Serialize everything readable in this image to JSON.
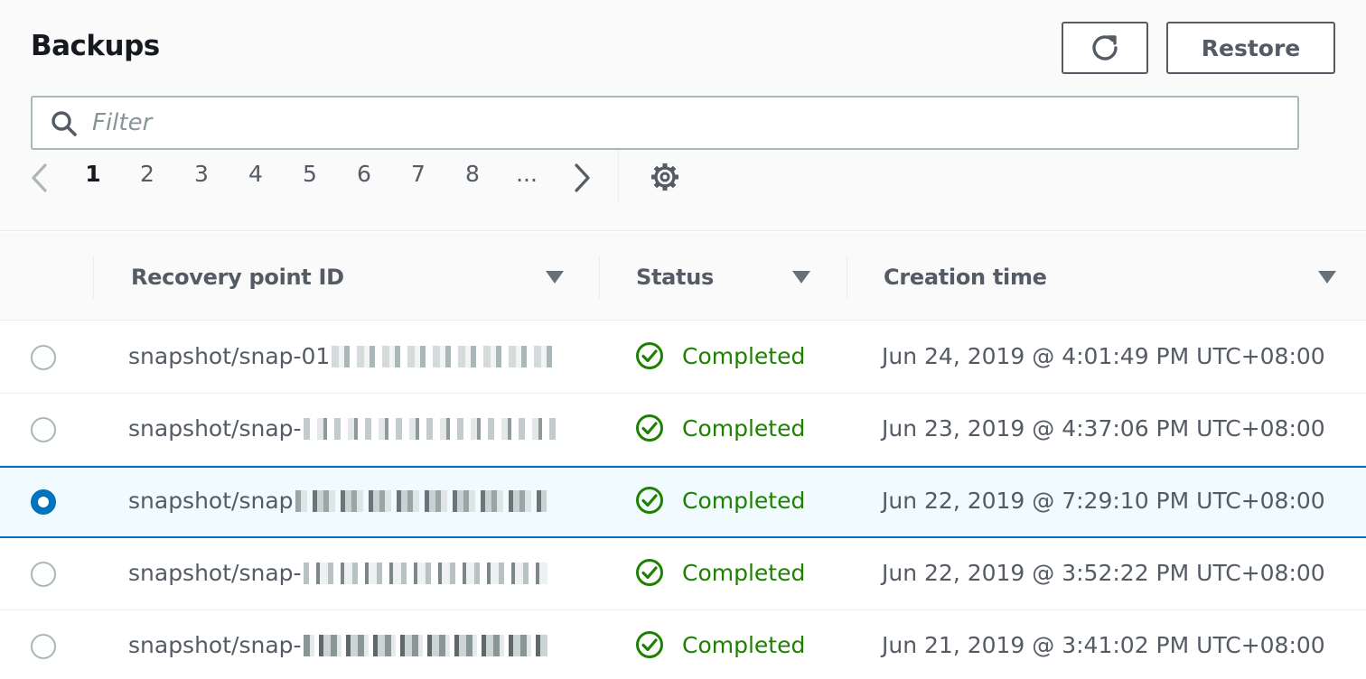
{
  "header": {
    "title": "Backups",
    "restore_label": "Restore"
  },
  "filter": {
    "placeholder": "Filter",
    "value": ""
  },
  "pagination": {
    "pages": [
      "1",
      "2",
      "3",
      "4",
      "5",
      "6",
      "7",
      "8"
    ],
    "ellipsis": "...",
    "current": "1"
  },
  "columns": {
    "recovery_point_id": "Recovery point ID",
    "status": "Status",
    "creation_time": "Creation time"
  },
  "rows": [
    {
      "id_prefix": "snapshot/snap-01",
      "status": "Completed",
      "creation_time": "Jun 24, 2019 @ 4:01:49 PM UTC+08:00",
      "selected": false
    },
    {
      "id_prefix": "snapshot/snap-",
      "status": "Completed",
      "creation_time": "Jun 23, 2019 @ 4:37:06 PM UTC+08:00",
      "selected": false
    },
    {
      "id_prefix": "snapshot/snap",
      "status": "Completed",
      "creation_time": "Jun 22, 2019 @ 7:29:10 PM UTC+08:00",
      "selected": true
    },
    {
      "id_prefix": "snapshot/snap-",
      "status": "Completed",
      "creation_time": "Jun 22, 2019 @ 3:52:22 PM UTC+08:00",
      "selected": false
    },
    {
      "id_prefix": "snapshot/snap-",
      "status": "Completed",
      "creation_time": "Jun 21, 2019 @ 3:41:02 PM UTC+08:00",
      "selected": false
    }
  ],
  "colors": {
    "accent": "#0073bb",
    "success": "#1d8102",
    "text_secondary": "#545b64",
    "border": "#eaeded"
  },
  "icons": {
    "refresh": "refresh-icon",
    "search": "search-icon",
    "prev": "chevron-left-icon",
    "next": "chevron-right-icon",
    "settings": "gear-icon",
    "sort": "caret-down-icon",
    "status_ok": "check-circle-icon"
  }
}
